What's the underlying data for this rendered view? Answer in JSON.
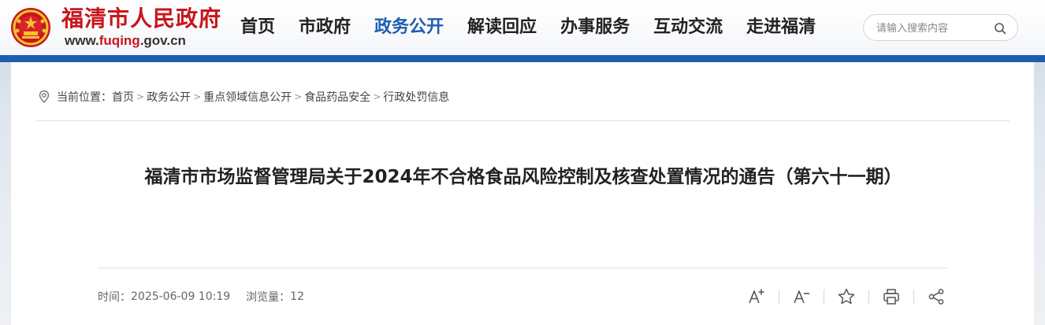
{
  "header": {
    "site_title": "福清市人民政府",
    "domain_prefix": "www.",
    "domain_highlight": "fuqing",
    "domain_suffix": ".gov.cn",
    "emblem_icon": "national-emblem-icon",
    "brand_red": "#c8161d",
    "brand_blue": "#1f5eae"
  },
  "nav": {
    "items": [
      {
        "label": "首页",
        "active": false
      },
      {
        "label": "市政府",
        "active": false
      },
      {
        "label": "政务公开",
        "active": true
      },
      {
        "label": "解读回应",
        "active": false
      },
      {
        "label": "办事服务",
        "active": false
      },
      {
        "label": "互动交流",
        "active": false
      },
      {
        "label": "走进福清",
        "active": false
      }
    ]
  },
  "search": {
    "placeholder": "请输入搜索内容",
    "value": "",
    "icon": "search-icon"
  },
  "breadcrumb": {
    "prefix": "当前位置：",
    "items": [
      "首页",
      "政务公开",
      "重点领域信息公开",
      "食品药品安全",
      "行政处罚信息"
    ],
    "separator": ">"
  },
  "article": {
    "title": "福清市市场监督管理局关于2024年不合格食品风险控制及核查处置情况的通告（第六十一期）",
    "time_label": "时间：",
    "time_value": "2025-06-09 10:19",
    "views_label": "浏览量：",
    "views_value": "12"
  },
  "tools": [
    {
      "name": "font-increase-icon"
    },
    {
      "name": "font-decrease-icon"
    },
    {
      "name": "star-icon"
    },
    {
      "name": "print-icon"
    },
    {
      "name": "share-icon"
    }
  ]
}
